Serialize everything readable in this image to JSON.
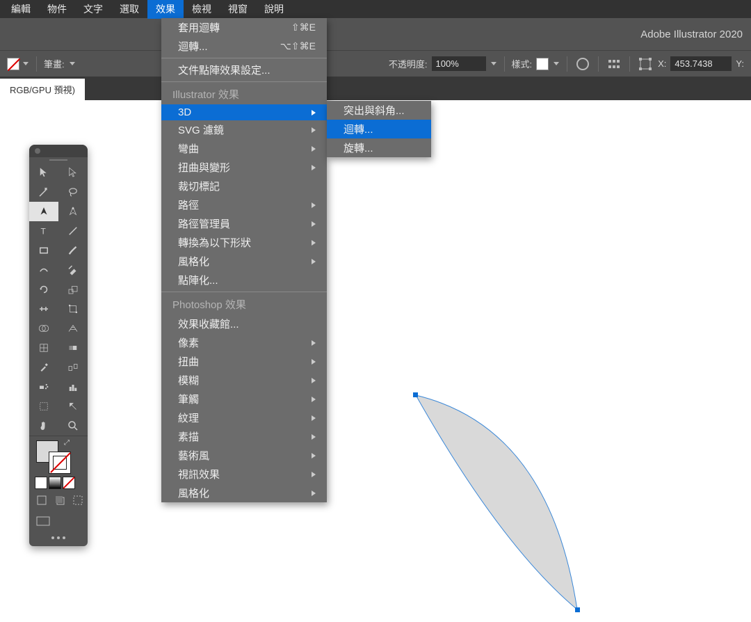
{
  "menubar": {
    "items": [
      "編輯",
      "物件",
      "文字",
      "選取",
      "效果",
      "檢視",
      "視窗",
      "說明"
    ],
    "active_index": 4
  },
  "titlebar": {
    "app": "Adobe Illustrator 2020"
  },
  "controlbar": {
    "stroke_label": "筆畫:",
    "opacity_label": "不透明度:",
    "opacity_value": "100%",
    "style_label": "樣式:",
    "x_label": "X:",
    "x_value": "453.7438",
    "y_label": "Y:"
  },
  "tabstrip": {
    "doc_tab": "RGB/GPU 預視)"
  },
  "effects_menu": {
    "top": [
      {
        "label": "套用迴轉",
        "shortcut": "⇧⌘E"
      },
      {
        "label": "迴轉...",
        "shortcut": "⌥⇧⌘E"
      }
    ],
    "raster_settings": "文件點陣效果設定...",
    "ai_header": "Illustrator 效果",
    "ai_items": [
      {
        "label": "3D",
        "arrow": true,
        "hl": true
      },
      {
        "label": "SVG 濾鏡",
        "arrow": true
      },
      {
        "label": "彎曲",
        "arrow": true
      },
      {
        "label": "扭曲與變形",
        "arrow": true
      },
      {
        "label": "裁切標記",
        "arrow": false
      },
      {
        "label": "路徑",
        "arrow": true
      },
      {
        "label": "路徑管理員",
        "arrow": true
      },
      {
        "label": "轉換為以下形狀",
        "arrow": true
      },
      {
        "label": "風格化",
        "arrow": true
      },
      {
        "label": "點陣化...",
        "arrow": false
      }
    ],
    "ps_header": "Photoshop 效果",
    "ps_items": [
      {
        "label": "效果收藏館...",
        "arrow": false
      },
      {
        "label": "像素",
        "arrow": true
      },
      {
        "label": "扭曲",
        "arrow": true
      },
      {
        "label": "模糊",
        "arrow": true
      },
      {
        "label": "筆觸",
        "arrow": true
      },
      {
        "label": "紋理",
        "arrow": true
      },
      {
        "label": "素描",
        "arrow": true
      },
      {
        "label": "藝術風",
        "arrow": true
      },
      {
        "label": "視訊效果",
        "arrow": true
      },
      {
        "label": "風格化",
        "arrow": true
      }
    ]
  },
  "submenu_3d": {
    "items": [
      {
        "label": "突出與斜角...",
        "hl": false
      },
      {
        "label": "迴轉...",
        "hl": true
      },
      {
        "label": "旋轉...",
        "hl": false
      }
    ]
  }
}
